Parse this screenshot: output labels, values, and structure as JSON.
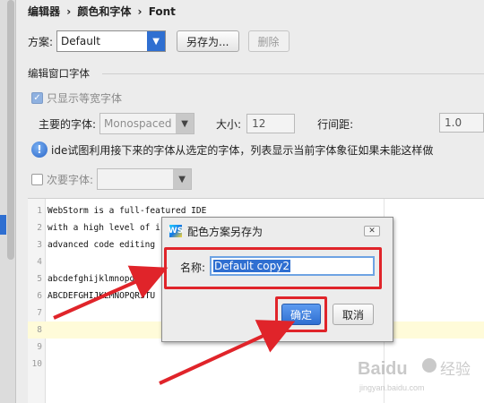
{
  "breadcrumb": [
    "编辑器",
    "›",
    "颜色和字体",
    "›",
    "Font"
  ],
  "scheme": {
    "label": "方案:",
    "value": "Default",
    "save_as": "另存为...",
    "delete": "删除"
  },
  "editor_font": {
    "group_title": "编辑窗口字体",
    "monospace_only": "只显示等宽字体",
    "primary_font_label": "主要的字体:",
    "primary_font_value": "Monospaced",
    "size_label": "大小:",
    "size_value": "12",
    "line_spacing_label": "行间距:",
    "line_spacing_value": "1.0",
    "info_text": "ide试图利用接下来的字体从选定的字体，列表显示当前字体象征如果未能这样做",
    "secondary_font_label": "次要字体:"
  },
  "preview_lines": [
    {
      "num": "1",
      "text": "WebStorm is a full-featured IDE"
    },
    {
      "num": "2",
      "text": "with a high level of i"
    },
    {
      "num": "3",
      "text": "advanced code editing"
    },
    {
      "num": "4",
      "text": ""
    },
    {
      "num": "5",
      "text": "abcdefghijklmnopqrs"
    },
    {
      "num": "6",
      "text": "ABCDEFGHIJKLMNOPQRSTU"
    },
    {
      "num": "7",
      "text": ""
    },
    {
      "num": "8",
      "text": ""
    },
    {
      "num": "9",
      "text": ""
    },
    {
      "num": "10",
      "text": ""
    }
  ],
  "dialog": {
    "title": "配色方案另存为",
    "app_icon": "WS",
    "name_label": "名称:",
    "name_value": "Default copy2",
    "ok": "确定",
    "cancel": "取消",
    "close": "✕"
  },
  "watermark": "Baidu 经验",
  "colors": {
    "accent": "#2f6fd1",
    "annotation": "#e0242a",
    "current_line": "#fffbd9"
  }
}
